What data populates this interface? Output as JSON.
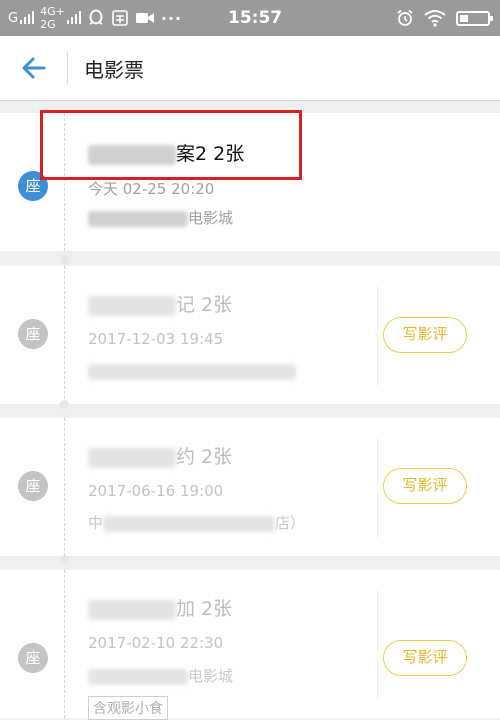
{
  "status_bar": {
    "sim1": "G",
    "sim2_top": "4G+",
    "sim2_bottom": "2G",
    "dots": "···",
    "time": "15:57"
  },
  "header": {
    "title": "电影票"
  },
  "tickets": [
    {
      "badge": "座",
      "name_suffix": "案2 2张",
      "date": "今天 02-25 20:20",
      "cinema_suffix": "电影城",
      "active": true
    },
    {
      "badge": "座",
      "name_suffix": "记 2张",
      "date": "2017-12-03 19:45",
      "review": "写影评",
      "active": false
    },
    {
      "badge": "座",
      "name_suffix": "约 2张",
      "date": "2017-06-16 19:00",
      "cinema_prefix": "中",
      "cinema_suffix": "店）",
      "review": "写影评",
      "active": false
    },
    {
      "badge": "座",
      "name_suffix": "加 2张",
      "date": "2017-02-10 22:30",
      "cinema_suffix": "电影城",
      "review": "写影评",
      "tag": "含观影小食",
      "active": false
    }
  ],
  "colors": {
    "accent_blue": "#3d8fd6",
    "badge_active": "#3d8fd6",
    "badge_inactive": "#c4c4c4",
    "review_yellow": "#f6c945",
    "highlight_red": "#d92020"
  }
}
